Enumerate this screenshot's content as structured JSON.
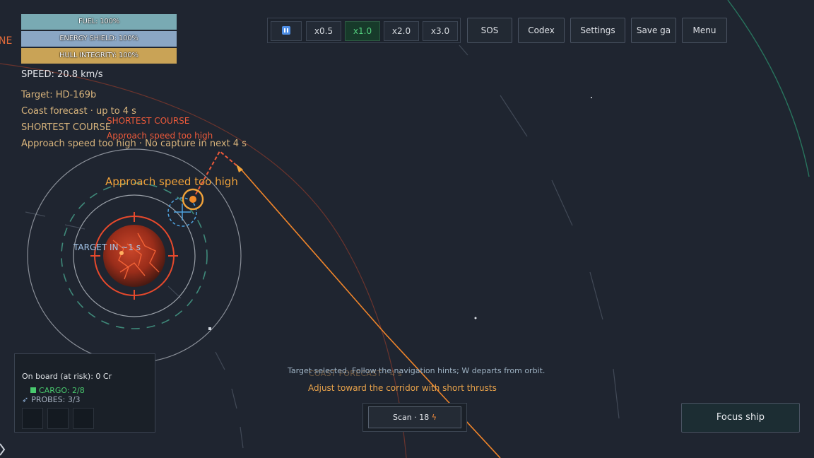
{
  "status": {
    "fuel": "FUEL: 100%",
    "shield": "ENERGY SHIELD: 100%",
    "hull": "HULL INTEGRITY: 100%",
    "fuel_level": 1.0,
    "shield_level": 1.0,
    "hull_level": 1.0
  },
  "nav": {
    "speed": "SPEED: 20.8 km/s",
    "target": "Target: HD-169b",
    "forecast": "Coast forecast · up to 4 s",
    "course": "SHORTEST COURSE",
    "approach": "Approach speed too high · No capture in next 4 s"
  },
  "toolbar": {
    "pause_icon": "pause-icon",
    "speeds": [
      "x0.5",
      "x1.0",
      "x2.0",
      "x3.0"
    ],
    "active_speed": "x1.0",
    "sos": "SOS",
    "codex": "Codex",
    "settings": "Settings",
    "save": "Save ga",
    "menu": "Menu"
  },
  "map_labels": {
    "edge": "NE",
    "shortest_course": "SHORTEST COURSE",
    "approach_small": "Approach speed too high",
    "approach_big": "Approach speed too high",
    "target_in": "TARGET IN ~1 s"
  },
  "cargo_panel": {
    "onboard": "On board (at risk): 0 Cr",
    "cargo": "CARGO: 2/8",
    "probes": "PROBES: 3/3",
    "cargo_icon": "cube-icon",
    "probes_icon": "rocket-icon"
  },
  "bottom": {
    "hint": "Target selected. Follow the navigation hints; W departs from orbit.",
    "coast_overlay": "COAST FORECAST · 4 s",
    "adjust": "Adjust toward the corridor with short thrusts",
    "scan": "Scan · 18",
    "scan_icon": "bolt-icon",
    "focus": "Focus ship"
  },
  "colors": {
    "background": "#1f2530",
    "planet": "#b8391f",
    "trajectory": "#f0852a",
    "shortest_course": "#ee5a3a",
    "target_marker": "#4fa3e0",
    "orbit": "#8a8f98",
    "accent_green": "#53d07e"
  }
}
